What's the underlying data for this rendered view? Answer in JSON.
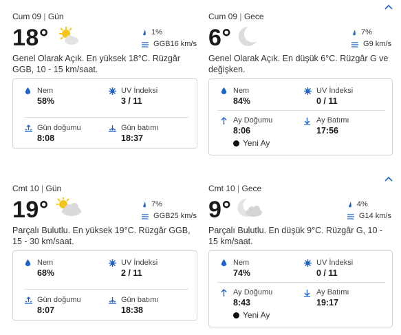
{
  "days": [
    {
      "day": {
        "date": "Cum 09",
        "period": "Gün",
        "temp": "18°",
        "icon": "sun-cloud-icon",
        "precip": "1%",
        "wind": "GGB16 km/s",
        "summary": "Genel Olarak Açık. En yüksek 18°C. Rüzgâr GGB, 10 - 15 km/saat.",
        "details": [
          {
            "label": "Nem",
            "value": "58%",
            "icon": "drop-icon"
          },
          {
            "label": "UV İndeksi",
            "value": "3 / 11",
            "icon": "uv-icon"
          },
          {
            "label": "Gün doğumu",
            "value": "8:08",
            "icon": "sunrise-icon"
          },
          {
            "label": "Gün batımı",
            "value": "18:37",
            "icon": "sunset-icon"
          }
        ]
      },
      "night": {
        "date": "Cum 09",
        "period": "Gece",
        "temp": "6°",
        "icon": "moon-icon",
        "precip": "7%",
        "wind": "G9 km/s",
        "summary": "Genel Olarak Açık. En düşük 6°C. Rüzgâr G ve değişken.",
        "details": [
          {
            "label": "Nem",
            "value": "84%",
            "icon": "drop-icon"
          },
          {
            "label": "UV İndeksi",
            "value": "0 / 11",
            "icon": "uv-icon"
          },
          {
            "label": "Ay Doğumu",
            "value": "8:06",
            "icon": "moonrise-icon"
          },
          {
            "label": "Ay Batımı",
            "value": "17:56",
            "icon": "moonset-icon"
          }
        ],
        "moon_phase": "Yeni Ay"
      }
    },
    {
      "day": {
        "date": "Cmt 10",
        "period": "Gün",
        "temp": "19°",
        "icon": "partly-cloudy-icon",
        "precip": "7%",
        "wind": "GGB25 km/s",
        "summary": "Parçalı Bulutlu. En yüksek 19°C. Rüzgâr GGB, 15 - 30 km/saat.",
        "details": [
          {
            "label": "Nem",
            "value": "68%",
            "icon": "drop-icon"
          },
          {
            "label": "UV İndeksi",
            "value": "2 / 11",
            "icon": "uv-icon"
          },
          {
            "label": "Gün doğumu",
            "value": "8:07",
            "icon": "sunrise-icon"
          },
          {
            "label": "Gün batımı",
            "value": "18:38",
            "icon": "sunset-icon"
          }
        ]
      },
      "night": {
        "date": "Cmt 10",
        "period": "Gece",
        "temp": "9°",
        "icon": "moon-cloud-icon",
        "precip": "4%",
        "wind": "G14 km/s",
        "summary": "Parçalı Bulutlu. En düşük 9°C. Rüzgâr G, 10 - 15 km/saat.",
        "details": [
          {
            "label": "Nem",
            "value": "74%",
            "icon": "drop-icon"
          },
          {
            "label": "UV İndeksi",
            "value": "0 / 11",
            "icon": "uv-icon"
          },
          {
            "label": "Ay Doğumu",
            "value": "8:43",
            "icon": "moonrise-icon"
          },
          {
            "label": "Ay Batımı",
            "value": "19:17",
            "icon": "moonset-icon"
          }
        ],
        "moon_phase": "Yeni Ay"
      }
    }
  ],
  "colors": {
    "accent": "#1f63c8",
    "sun": "#f5c518",
    "cloud": "#d9d9d9"
  }
}
